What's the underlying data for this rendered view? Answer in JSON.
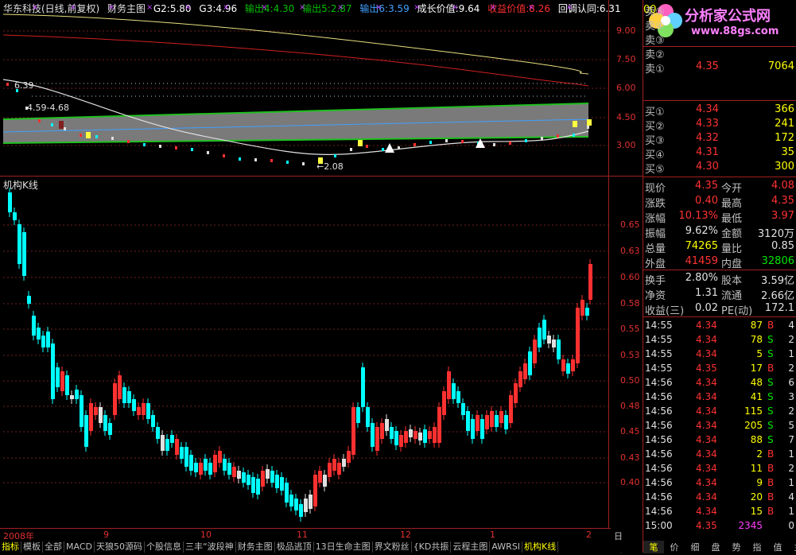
{
  "header": {
    "stock": "华东科技(日线,前复权)",
    "indicator": "财务主图",
    "g2": "G2:5.80",
    "g3": "G3:4.96",
    "out4": "输出4:4.30",
    "out5": "输出5:2.87",
    "out6": "输出6:3.59",
    "growth": "成长价值:9.64",
    "income": "收益价值:8.26",
    "approval": "回调认同:6.31"
  },
  "top_axis": [
    "9.00",
    "7.50",
    "6.00",
    "4.50",
    "3.00"
  ],
  "top_annotations": {
    "high": "6.39",
    "range": "4.59-4.68",
    "low": "←2.08"
  },
  "bottom_title": "机构K线",
  "bottom_axis": [
    "0.65",
    "0.63",
    "0.60",
    "0.58",
    "0.55",
    "0.53",
    "0.50",
    "0.48",
    "0.45",
    "0.43",
    "0.40"
  ],
  "dates": [
    "2008年",
    "9",
    "10",
    "11",
    "12",
    "1",
    "2"
  ],
  "period_label": "日线",
  "tabs": [
    "指标",
    "模板",
    "全部",
    "MACD",
    "天狼50源码",
    "个股信息",
    "三丰“波段神",
    "财务主图",
    "极品逃顶",
    "13日生命主图",
    "界文粉丝",
    "{KD共振",
    "云程主图",
    "AWRSI",
    "机构K线"
  ],
  "active_tab": "机构K线",
  "logo": {
    "top": "00",
    "brand": "分析家公式网",
    "url": "www.88gs.com"
  },
  "sell_orders": [
    {
      "label": "卖⑤",
      "price": "",
      "vol": ""
    },
    {
      "label": "卖④",
      "price": "",
      "vol": ""
    },
    {
      "label": "卖③",
      "price": "",
      "vol": ""
    },
    {
      "label": "卖②",
      "price": "",
      "vol": ""
    },
    {
      "label": "卖①",
      "price": "4.35",
      "vol": "7064"
    }
  ],
  "buy_orders": [
    {
      "label": "买①",
      "price": "4.34",
      "vol": "366"
    },
    {
      "label": "买②",
      "price": "4.33",
      "vol": "241"
    },
    {
      "label": "买③",
      "price": "4.32",
      "vol": "172"
    },
    {
      "label": "买④",
      "price": "4.31",
      "vol": "35"
    },
    {
      "label": "买⑤",
      "price": "4.30",
      "vol": "300"
    }
  ],
  "quote": [
    {
      "l1": "现价",
      "v1": "4.35",
      "c1": "red",
      "l2": "今开",
      "v2": "4.08",
      "c2": "red"
    },
    {
      "l1": "涨跌",
      "v1": "0.40",
      "c1": "red",
      "l2": "最高",
      "v2": "4.35",
      "c2": "red"
    },
    {
      "l1": "涨幅",
      "v1": "10.13%",
      "c1": "red",
      "l2": "最低",
      "v2": "3.97",
      "c2": "red"
    },
    {
      "l1": "振幅",
      "v1": "9.62%",
      "c1": "white",
      "l2": "金额",
      "v2": "3120万",
      "c2": "white"
    },
    {
      "l1": "总量",
      "v1": "74265",
      "c1": "yellow",
      "l2": "量比",
      "v2": "0.85",
      "c2": "white"
    },
    {
      "l1": "外盘",
      "v1": "41459",
      "c1": "red",
      "l2": "内盘",
      "v2": "32806",
      "c2": "green"
    }
  ],
  "finance": [
    {
      "l1": "换手",
      "v1": "2.80%",
      "l2": "股本",
      "v2": "3.59亿"
    },
    {
      "l1": "净资",
      "v1": "1.31",
      "l2": "流通",
      "v2": "2.66亿"
    },
    {
      "l1": "收益(三)",
      "v1": "0.02",
      "l2": "PE(动)",
      "v2": "172.1"
    }
  ],
  "ticks": [
    {
      "t": "14:55",
      "p": "4.34",
      "v": "87",
      "s": "B",
      "n": "4"
    },
    {
      "t": "14:55",
      "p": "4.34",
      "v": "78",
      "s": "S",
      "n": "2"
    },
    {
      "t": "14:55",
      "p": "4.34",
      "v": "5",
      "s": "S",
      "n": "1"
    },
    {
      "t": "14:55",
      "p": "4.35",
      "v": "17",
      "s": "B",
      "n": "2"
    },
    {
      "t": "14:56",
      "p": "4.34",
      "v": "48",
      "s": "S",
      "n": "6"
    },
    {
      "t": "14:56",
      "p": "4.34",
      "v": "41",
      "s": "S",
      "n": "3"
    },
    {
      "t": "14:56",
      "p": "4.34",
      "v": "115",
      "s": "S",
      "n": "2"
    },
    {
      "t": "14:56",
      "p": "4.34",
      "v": "205",
      "s": "S",
      "n": "5"
    },
    {
      "t": "14:56",
      "p": "4.34",
      "v": "88",
      "s": "S",
      "n": "7"
    },
    {
      "t": "14:56",
      "p": "4.34",
      "v": "2",
      "s": "B",
      "n": "1"
    },
    {
      "t": "14:56",
      "p": "4.34",
      "v": "11",
      "s": "B",
      "n": "2"
    },
    {
      "t": "14:56",
      "p": "4.34",
      "v": "9",
      "s": "B",
      "n": "1"
    },
    {
      "t": "14:56",
      "p": "4.34",
      "v": "20",
      "s": "B",
      "n": "4"
    },
    {
      "t": "14:56",
      "p": "4.34",
      "v": "15",
      "s": "B",
      "n": "1"
    },
    {
      "t": "15:00",
      "p": "4.35",
      "v": "2345",
      "s": "",
      "n": "0"
    }
  ],
  "right_tabs": [
    "笔",
    "价",
    "细",
    "盘",
    "势",
    "指",
    "值",
    "主"
  ],
  "active_right_tab": "笔"
}
